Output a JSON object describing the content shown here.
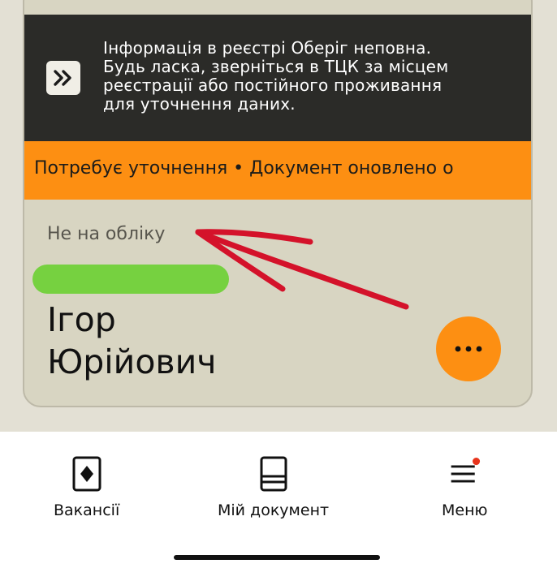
{
  "info_banner": {
    "icon": "double-chevron-right-icon",
    "lines": [
      "Інформація в реєстрі Оберіг неповна.",
      "Будь ласка, зверніться в ТЦК за місцем",
      "реєстрації або постійного проживання",
      "для уточнення даних."
    ]
  },
  "status_strip": {
    "text": "Потребує уточнення • Документ оновлено о"
  },
  "card": {
    "registration_status": "Не на обліку",
    "name_lines": [
      "Ігор",
      "Юрійович"
    ],
    "more_icon": "more-dots-icon",
    "redaction_color": "#76d140",
    "annotation_color": "#d4122a"
  },
  "colors": {
    "accent_orange": "#fd8f12",
    "banner_dark": "#2b2b28",
    "card_bg": "#d8d5c2"
  },
  "bottom_nav": {
    "items": [
      {
        "label": "Вакансії",
        "icon": "vacancies-icon"
      },
      {
        "label": "Мій документ",
        "icon": "document-icon"
      },
      {
        "label": "Меню",
        "icon": "menu-icon"
      }
    ]
  }
}
